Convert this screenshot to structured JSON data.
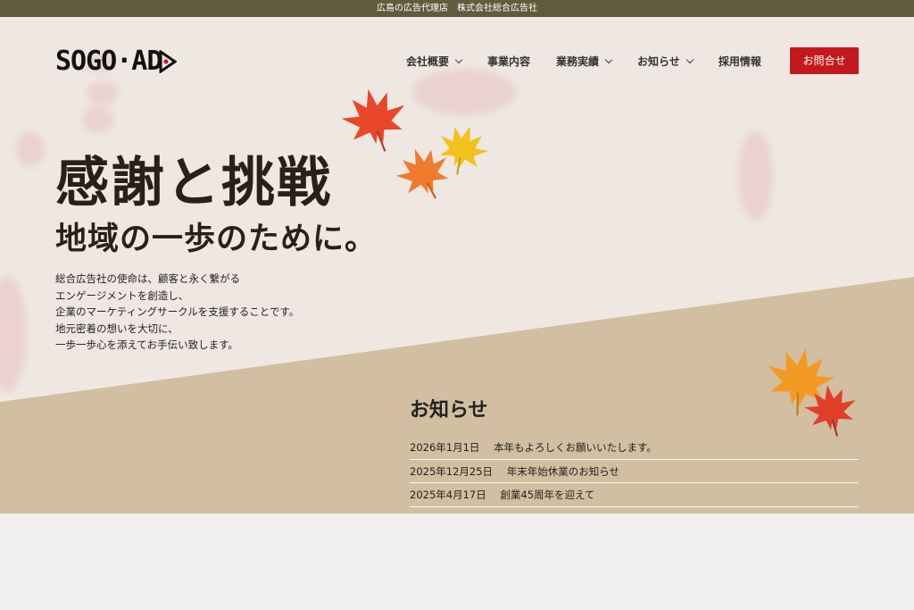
{
  "topbar": {
    "text": "広島の広告代理店　株式会社総合広告社"
  },
  "logo": {
    "text": "SOGO·AD"
  },
  "nav": {
    "items": [
      {
        "label": "会社概要",
        "dropdown": true
      },
      {
        "label": "事業内容",
        "dropdown": false
      },
      {
        "label": "業務実績",
        "dropdown": true
      },
      {
        "label": "お知らせ",
        "dropdown": true
      },
      {
        "label": "採用情報",
        "dropdown": false
      }
    ],
    "contact_label": "お問合せ"
  },
  "hero": {
    "headline": "感謝と挑戦",
    "subline": "地域の一歩のために。",
    "mission": [
      "総合広告社の使命は、顧客と永く繋がる",
      "エンゲージメントを創造し、",
      "企業のマーケティングサークルを支援することです。",
      "地元密着の想いを大切に、",
      "一歩一歩心を添えてお手伝い致します。"
    ]
  },
  "news": {
    "title": "お知らせ",
    "items": [
      {
        "date": "2026年1月1日",
        "text": "本年もよろしくお願いいたします。"
      },
      {
        "date": "2025年12月25日",
        "text": "年末年始休業のお知らせ"
      },
      {
        "date": "2025年4月17日",
        "text": "創業45周年を迎えて"
      }
    ]
  },
  "colors": {
    "topbar": "#625a3c",
    "hero_bg": "#efe8e2",
    "slope_band": "#d2bea1",
    "accent_red": "#c4191b",
    "page_bg": "#f0efee"
  },
  "icons": {
    "dropdown": "chevron-down-icon",
    "leaf": "maple-leaf-icon",
    "logo_mark": "play-triangle-icon"
  }
}
